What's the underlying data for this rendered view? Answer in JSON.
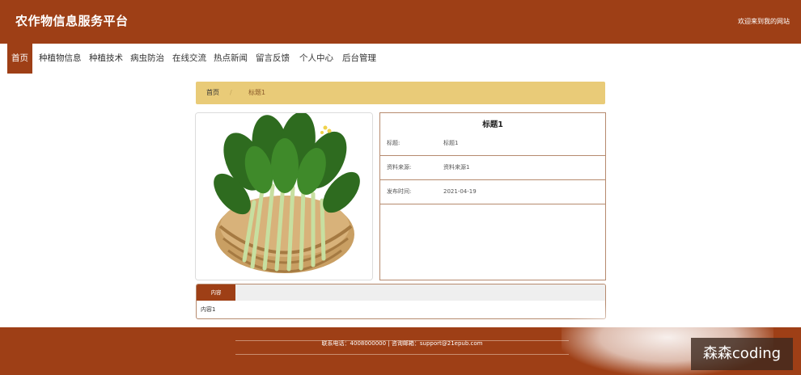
{
  "header": {
    "site_title": "农作物信息服务平台",
    "welcome": "欢迎来到我的网站"
  },
  "nav": {
    "items": [
      {
        "label": "首页",
        "active": true
      },
      {
        "label": "种植物信息"
      },
      {
        "label": "种植技术"
      },
      {
        "label": "病虫防治"
      },
      {
        "label": "在线交流"
      },
      {
        "label": "热点新闻"
      },
      {
        "label": "留言反馈"
      },
      {
        "label": "个人中心"
      },
      {
        "label": "后台管理"
      }
    ]
  },
  "breadcrumb": {
    "home": "首页",
    "separator": "/",
    "current": "标题1"
  },
  "detail": {
    "title": "标题1",
    "image_icon": "leafy-greens-basket-image",
    "rows": [
      {
        "label": "标题:",
        "value": "标题1"
      },
      {
        "label": "资料来源:",
        "value": "资料来源1"
      },
      {
        "label": "发布时间:",
        "value": "2021-04-19"
      }
    ]
  },
  "content": {
    "tab_label": "内容",
    "text": "内容1"
  },
  "footer": {
    "contact": "联系电话：4008000000 | 咨询邮箱：support@21epub.com"
  },
  "watermark": "森森coding",
  "colors": {
    "brand": "#9e3f16",
    "breadcrumb_bg": "#e9cb78",
    "border": "#b68a6e"
  }
}
